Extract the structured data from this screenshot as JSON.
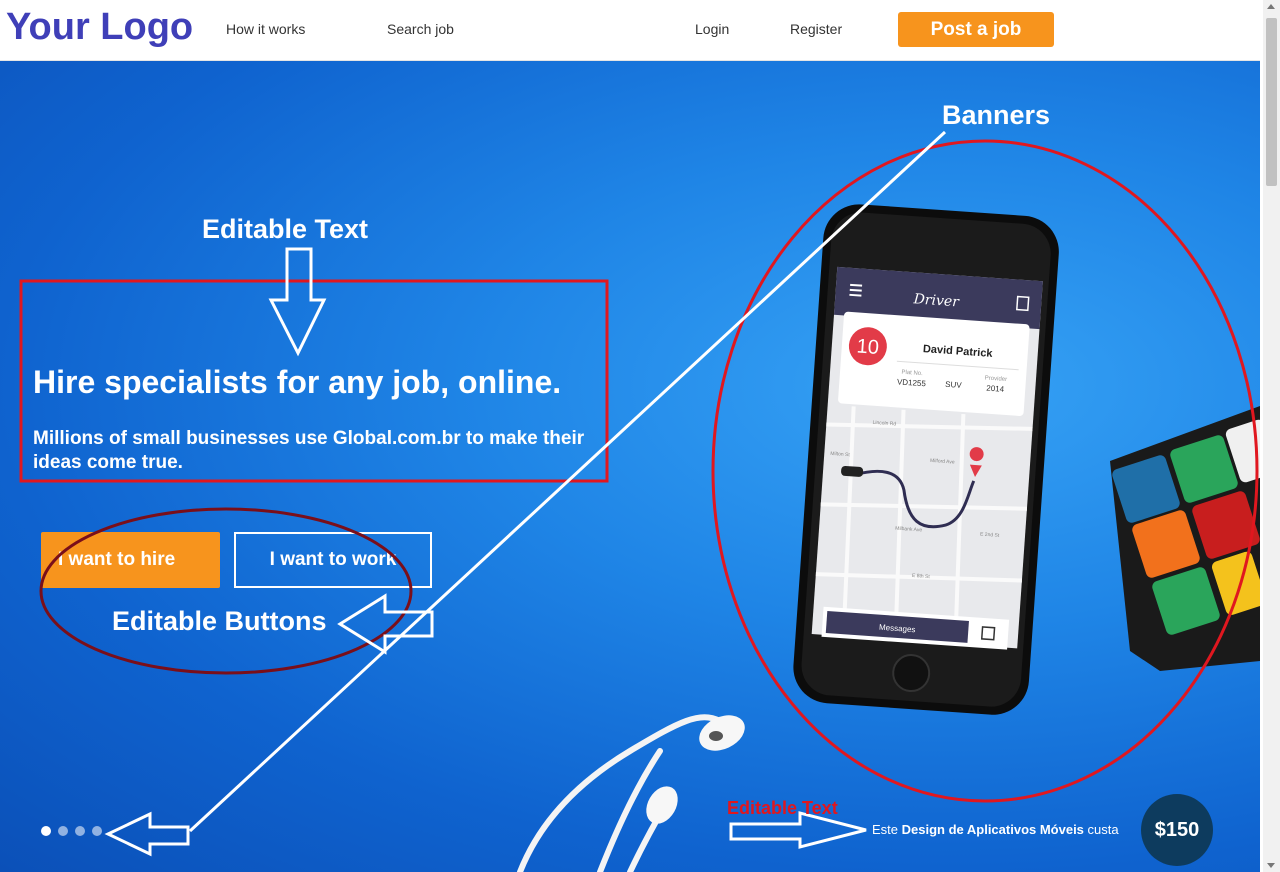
{
  "header": {
    "logo": "Your Logo",
    "nav": {
      "how_it_works": "How it works",
      "search_job": "Search job",
      "login": "Login",
      "register": "Register"
    },
    "post_job": "Post a job"
  },
  "hero": {
    "headline": "Hire specialists for any job, online.",
    "subline": "Millions of small businesses use Global.com.br to make their ideas come true.",
    "hire_button": "I want to hire",
    "work_button": "I want to work",
    "slides_count": 4,
    "active_slide": 1,
    "caption": {
      "prefix": "Este ",
      "bold": "Design de Aplicativos Móveis",
      "suffix": " custa"
    },
    "price": "$150"
  },
  "phone": {
    "app_title": "Driver",
    "badge_number": "10",
    "driver_name": "David Patrick",
    "plate_label": "Plat No.",
    "plate_value": "VD1255",
    "type_value": "SUV",
    "year_label": "Provider",
    "year_value": "2014",
    "messages_button": "Messages",
    "streets": [
      "Lincoln Rd",
      "Milford Ave",
      "E 8th St",
      "Milbank Ave",
      "E 2nd St",
      "Milton St"
    ]
  },
  "annotations": {
    "banners": "Banners",
    "editable_text": "Editable Text",
    "editable_buttons": "Editable Buttons",
    "editable_text_red": "Editable Text"
  },
  "colors": {
    "logo": "#3f3fb8",
    "accent_orange": "#f7941d",
    "hero_blue": "#1f85e6",
    "annotation_red": "#e0171f",
    "annotation_darkred": "#7a0f1a",
    "price_circle": "#0d3b5e"
  }
}
